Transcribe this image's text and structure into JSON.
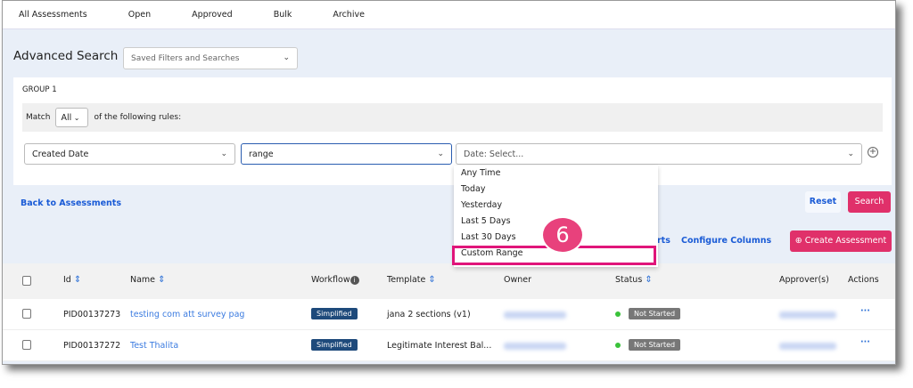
{
  "tabs": [
    "All Assessments",
    "Open",
    "Approved",
    "Bulk",
    "Archive"
  ],
  "search": {
    "title": "Advanced Search",
    "saved_placeholder": "Saved Filters and Searches"
  },
  "group": {
    "label": "GROUP 1",
    "match_prefix": "Match",
    "match_value": "All",
    "match_suffix": "of the following rules:"
  },
  "rule": {
    "field": "Created Date",
    "operator": "range",
    "value_placeholder": "Date: Select..."
  },
  "dropdown": {
    "options": [
      "Any Time",
      "Today",
      "Yesterday",
      "Last 5 Days",
      "Last 30 Days",
      "Custom Range"
    ],
    "highlighted": "Custom Range"
  },
  "step_badge": "6",
  "actions": {
    "back": "Back to Assessments",
    "reset": "Reset",
    "search": "Search",
    "reports_partial": "rts",
    "configure": "Configure Columns",
    "create": "Create Assessment"
  },
  "table": {
    "headers": [
      "Id",
      "Name",
      "Workflow",
      "Template",
      "Owner",
      "Status",
      "Approver(s)",
      "Actions"
    ],
    "rows": [
      {
        "id": "PID00137273",
        "name": "testing com att survey pag",
        "workflow": "Simplified",
        "template": "jana 2 sections (v1)",
        "status": "Not Started"
      },
      {
        "id": "PID00137272",
        "name": "Test Thalita",
        "workflow": "Simplified",
        "template": "Legitimate Interest Bal...",
        "status": "Not Started"
      }
    ]
  },
  "colors": {
    "accent": "#e0306a",
    "highlight_border": "#e0157a",
    "link": "#1a5bd6",
    "workflow_badge": "#1e4a7b"
  }
}
